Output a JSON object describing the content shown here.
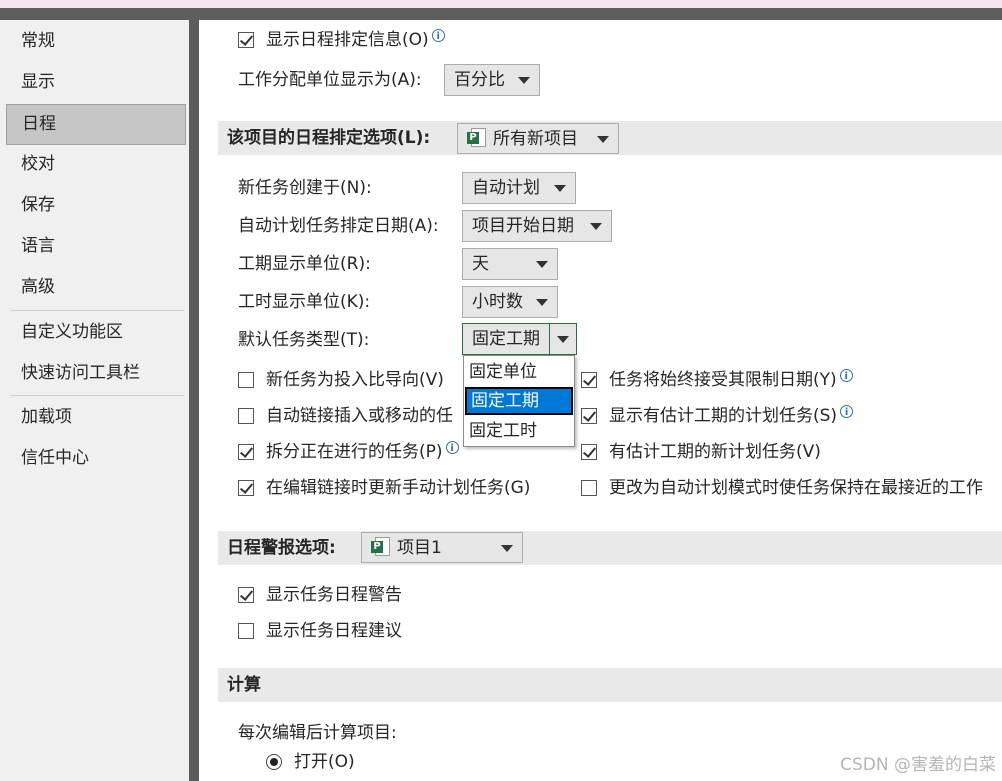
{
  "sidebar": {
    "items": [
      {
        "label": "常规"
      },
      {
        "label": "显示"
      },
      {
        "label": "日程",
        "selected": true
      },
      {
        "label": "校对"
      },
      {
        "label": "保存"
      },
      {
        "label": "语言"
      },
      {
        "label": "高级"
      },
      {
        "label": "自定义功能区"
      },
      {
        "label": "快速访问工具栏"
      },
      {
        "label": "加载项"
      },
      {
        "label": "信任中心"
      }
    ]
  },
  "top": {
    "show_scheduling_info": {
      "label": "显示日程排定信息(O)",
      "checked": true
    },
    "work_unit_label": "工作分配单位显示为(A):",
    "work_unit_value": "百分比"
  },
  "project_section": {
    "title": "该项目的日程排定选项(L):",
    "project_value": "所有新项目",
    "new_task_label": "新任务创建于(N):",
    "new_task_value": "自动计划",
    "auto_date_label": "自动计划任务排定日期(A):",
    "auto_date_value": "项目开始日期",
    "duration_unit_label": "工期显示单位(R):",
    "duration_unit_value": "天",
    "work_unit2_label": "工时显示单位(K):",
    "work_unit2_value": "小时数",
    "task_type_label": "默认任务类型(T):",
    "task_type_value": "固定工期",
    "task_type_options": [
      "固定单位",
      "固定工期",
      "固定工时"
    ],
    "left_checks": [
      {
        "label": "新任务为投入比导向(V)",
        "checked": false
      },
      {
        "label": "自动链接插入或移动的任",
        "checked": false
      },
      {
        "label": "拆分正在进行的任务(P)",
        "checked": true
      },
      {
        "label": "在编辑链接时更新手动计划任务(G)",
        "checked": true
      }
    ],
    "right_checks": [
      {
        "label": "任务将始终接受其限制日期(Y)",
        "checked": true
      },
      {
        "label": "显示有估计工期的计划任务(S)",
        "checked": true
      },
      {
        "label": "有估计工期的新计划任务(V)",
        "checked": true
      },
      {
        "label": "更改为自动计划模式时使任务保持在最接近的工作",
        "checked": false
      }
    ]
  },
  "alerts_section": {
    "title": "日程警报选项:",
    "project_value": "项目1",
    "checks": [
      {
        "label": "显示任务日程警告",
        "checked": true
      },
      {
        "label": "显示任务日程建议",
        "checked": false
      }
    ]
  },
  "calc_section": {
    "title": "计算",
    "calc_label": "每次编辑后计算项目:",
    "on_label": "打开(O)"
  },
  "icons": {
    "project_file": "project-file-icon",
    "info": "info-icon"
  },
  "colors": {
    "accent": "#217346",
    "highlight": "#0078d7",
    "selected_nav": "#c6c6c6"
  },
  "watermark": "CSDN @害羞的白菜"
}
